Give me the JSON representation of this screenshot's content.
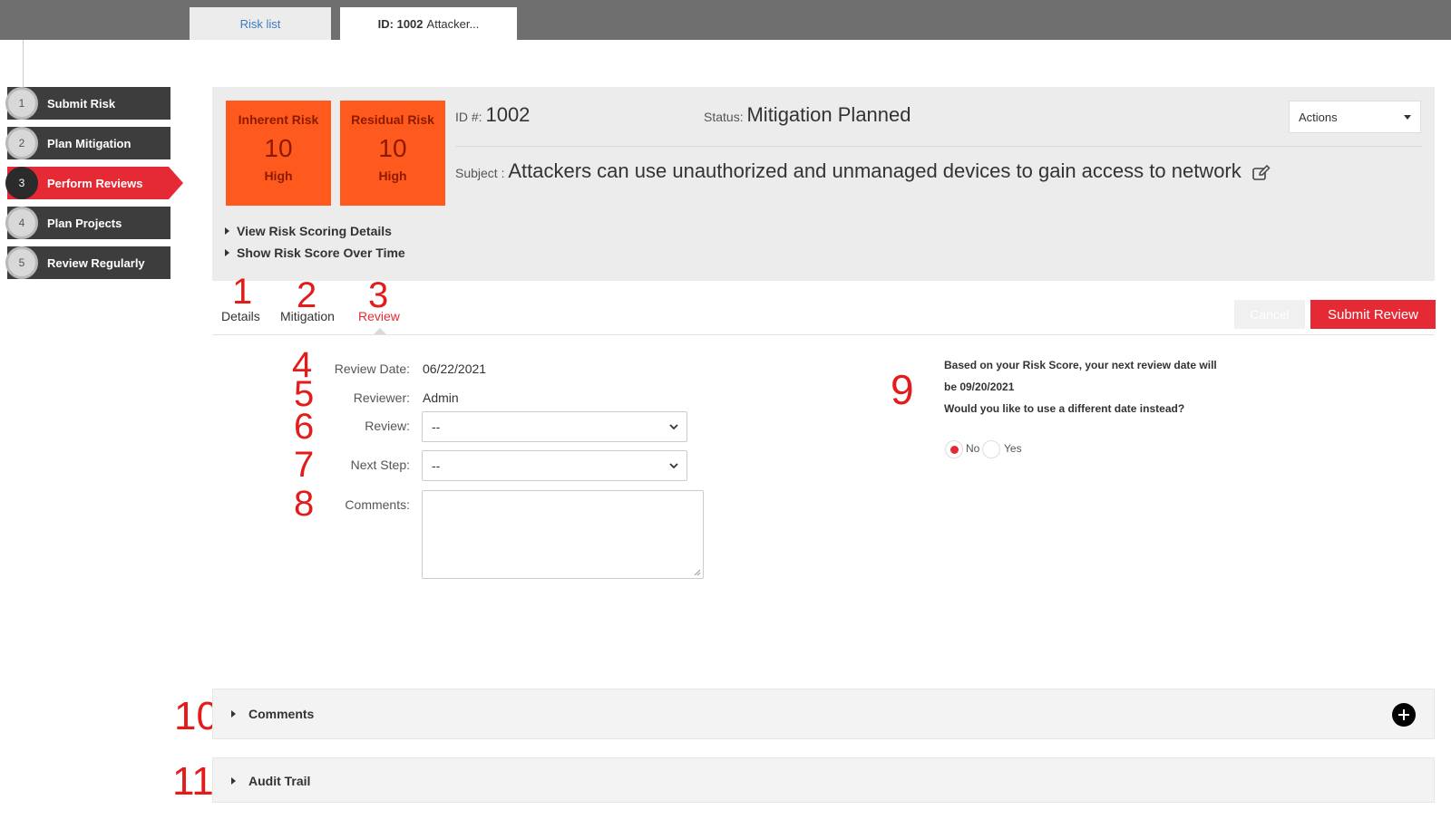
{
  "tabs": {
    "risk_list": "Risk list",
    "active_id": "ID: 1002",
    "active_title": "Attacker..."
  },
  "steps": [
    {
      "num": "1",
      "label": "Submit Risk"
    },
    {
      "num": "2",
      "label": "Plan Mitigation"
    },
    {
      "num": "3",
      "label": "Perform Reviews"
    },
    {
      "num": "4",
      "label": "Plan Projects"
    },
    {
      "num": "5",
      "label": "Review Regularly"
    }
  ],
  "risk": {
    "inherent": {
      "title": "Inherent Risk",
      "value": "10",
      "level": "High"
    },
    "residual": {
      "title": "Residual Risk",
      "value": "10",
      "level": "High"
    },
    "id_label": "ID #:",
    "id_value": "1002",
    "status_label": "Status:",
    "status_value": "Mitigation Planned",
    "subject_label": "Subject :",
    "subject_value": "Attackers can use unauthorized and unmanaged devices to gain access to network",
    "actions_label": "Actions",
    "view_scoring": "View Risk Scoring Details",
    "show_score_time": "Show Risk Score Over Time"
  },
  "subtabs": {
    "details": "Details",
    "mitigation": "Mitigation",
    "review": "Review"
  },
  "buttons": {
    "cancel": "Cancel",
    "submit": "Submit Review"
  },
  "form": {
    "review_date_label": "Review Date:",
    "review_date_value": "06/22/2021",
    "reviewer_label": "Reviewer:",
    "reviewer_value": "Admin",
    "review_label": "Review:",
    "review_value": "--",
    "next_step_label": "Next Step:",
    "next_step_value": "--",
    "comments_label": "Comments:"
  },
  "next_review": {
    "line1": "Based on your Risk Score, your next review date will",
    "line2": "be 09/20/2021",
    "line3": "Would you like to use a different date instead?",
    "no_label": "No",
    "yes_label": "Yes",
    "selected": "No"
  },
  "accordions": {
    "comments": "Comments",
    "audit_trail": "Audit Trail"
  },
  "annotations": [
    "1",
    "2",
    "3",
    "4",
    "5",
    "6",
    "7",
    "8",
    "9",
    "10",
    "11"
  ],
  "colors": {
    "accent_red": "#e52a35",
    "risk_orange": "#fe5a1e",
    "annotation_red": "#e31b1b"
  }
}
